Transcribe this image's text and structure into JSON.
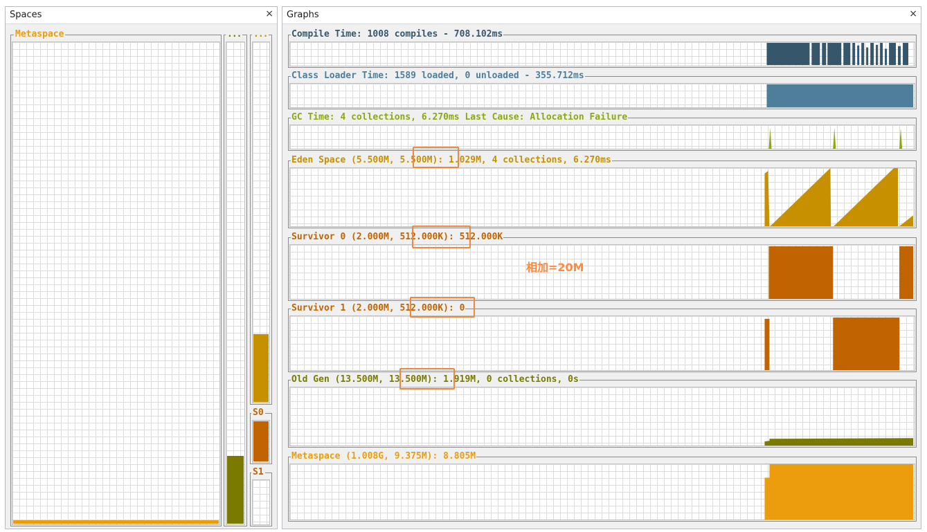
{
  "spaces_panel": {
    "title": "Spaces",
    "close": "×",
    "metaspace_label": "Metaspace",
    "old_label": "...",
    "eden_label": "...",
    "s0_label": "S0",
    "s1_label": "S1",
    "metaspace_fill": 0.01,
    "old_fill": 0.14,
    "eden_fill": 0.19,
    "s0_fill": 1.0,
    "s1_fill": 0.0
  },
  "graphs_panel": {
    "title": "Graphs",
    "close": "×",
    "graphs": [
      {
        "label": "Compile Time: 1008 compiles - 708.102ms",
        "color": "#36576b"
      },
      {
        "label": "Class Loader Time: 1589 loaded, 0 unloaded - 355.712ms",
        "color": "#4f7e9b"
      },
      {
        "label": "GC Time: 4 collections, 6.270ms Last Cause: Allocation Failure",
        "color": "#8aa80f"
      },
      {
        "label": "Eden Space (5.500M, 5.500M): 1.029M, 4 collections, 6.270ms",
        "color": "#c69000"
      },
      {
        "label": "Survivor 0 (2.000M, 512.000K): 512.000K",
        "color": "#c16300"
      },
      {
        "label": "Survivor 1 (2.000M, 512.000K): 0",
        "color": "#c16300"
      },
      {
        "label": "Old Gen (13.500M, 13.500M): 1.919M, 0 collections, 0s",
        "color": "#7a7a00"
      },
      {
        "label": "Metaspace (1.008G, 9.375M): 8.805M",
        "color": "#eb9d0e"
      }
    ]
  },
  "annotation": "相加=20M",
  "colors": {
    "compile": "#36576b",
    "classloader": "#4f7e9b",
    "gc": "#8aa80f",
    "eden": "#c69000",
    "survivor": "#c16300",
    "old": "#7a7a00",
    "metaspace": "#eb9d0e",
    "highlight": "#f4863a"
  }
}
